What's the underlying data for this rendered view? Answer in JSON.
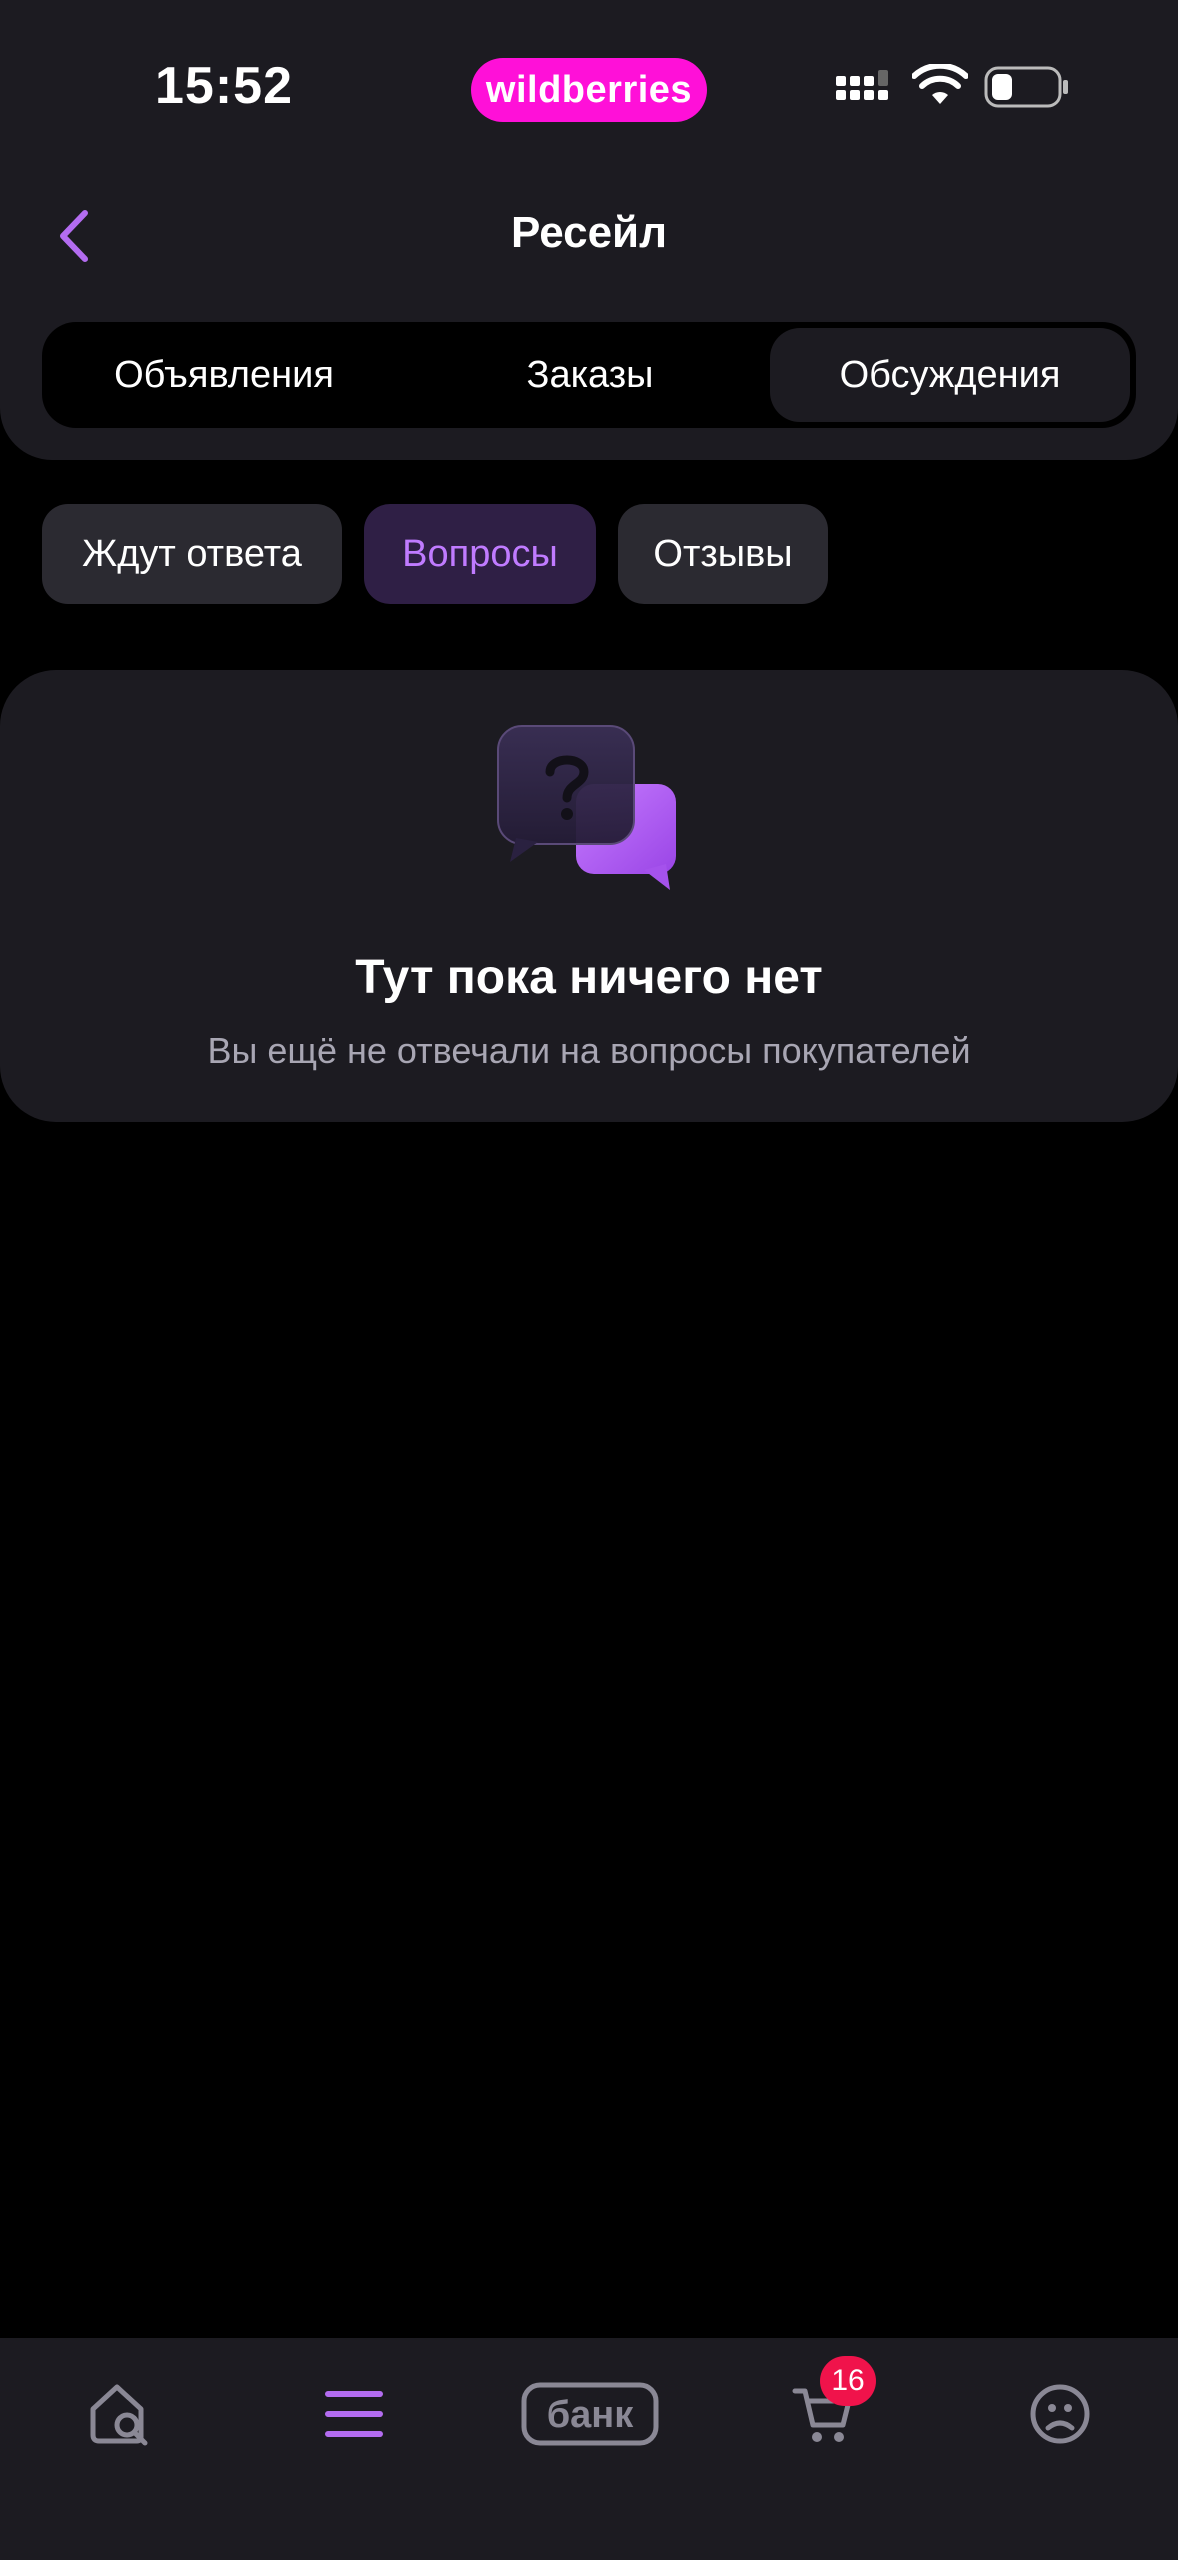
{
  "status_bar": {
    "time": "15:52",
    "brand": "wildberries",
    "icons": [
      "signal-icon",
      "wifi-icon",
      "battery-icon"
    ]
  },
  "nav": {
    "back_icon": "chevron-left-icon",
    "title": "Ресейл"
  },
  "segmented": {
    "items": [
      {
        "label": "Объявления",
        "selected": false
      },
      {
        "label": "Заказы",
        "selected": false
      },
      {
        "label": "Обсуждения",
        "selected": true
      }
    ]
  },
  "filters": {
    "items": [
      {
        "label": "Ждут ответа",
        "selected": false
      },
      {
        "label": "Вопросы",
        "selected": true
      },
      {
        "label": "Отзывы",
        "selected": false
      }
    ]
  },
  "empty_state": {
    "icon": "chat-question-icon",
    "title": "Тут пока ничего нет",
    "subtitle": "Вы ещё не отвечали на вопросы покупателей"
  },
  "tabbar": {
    "items": [
      {
        "icon": "home-search-icon",
        "active": false
      },
      {
        "icon": "menu-icon",
        "active": true
      },
      {
        "icon": "bank-icon",
        "label": "банк",
        "active": false
      },
      {
        "icon": "cart-icon",
        "active": false,
        "badge": "16"
      },
      {
        "icon": "profile-icon",
        "active": false
      }
    ]
  },
  "colors": {
    "accent": "#c07bff",
    "brand": "#ff10d8",
    "surface": "#1c1b21",
    "background": "#000000",
    "badge": "#f0134b",
    "secondary_text": "#a8a6b3"
  }
}
